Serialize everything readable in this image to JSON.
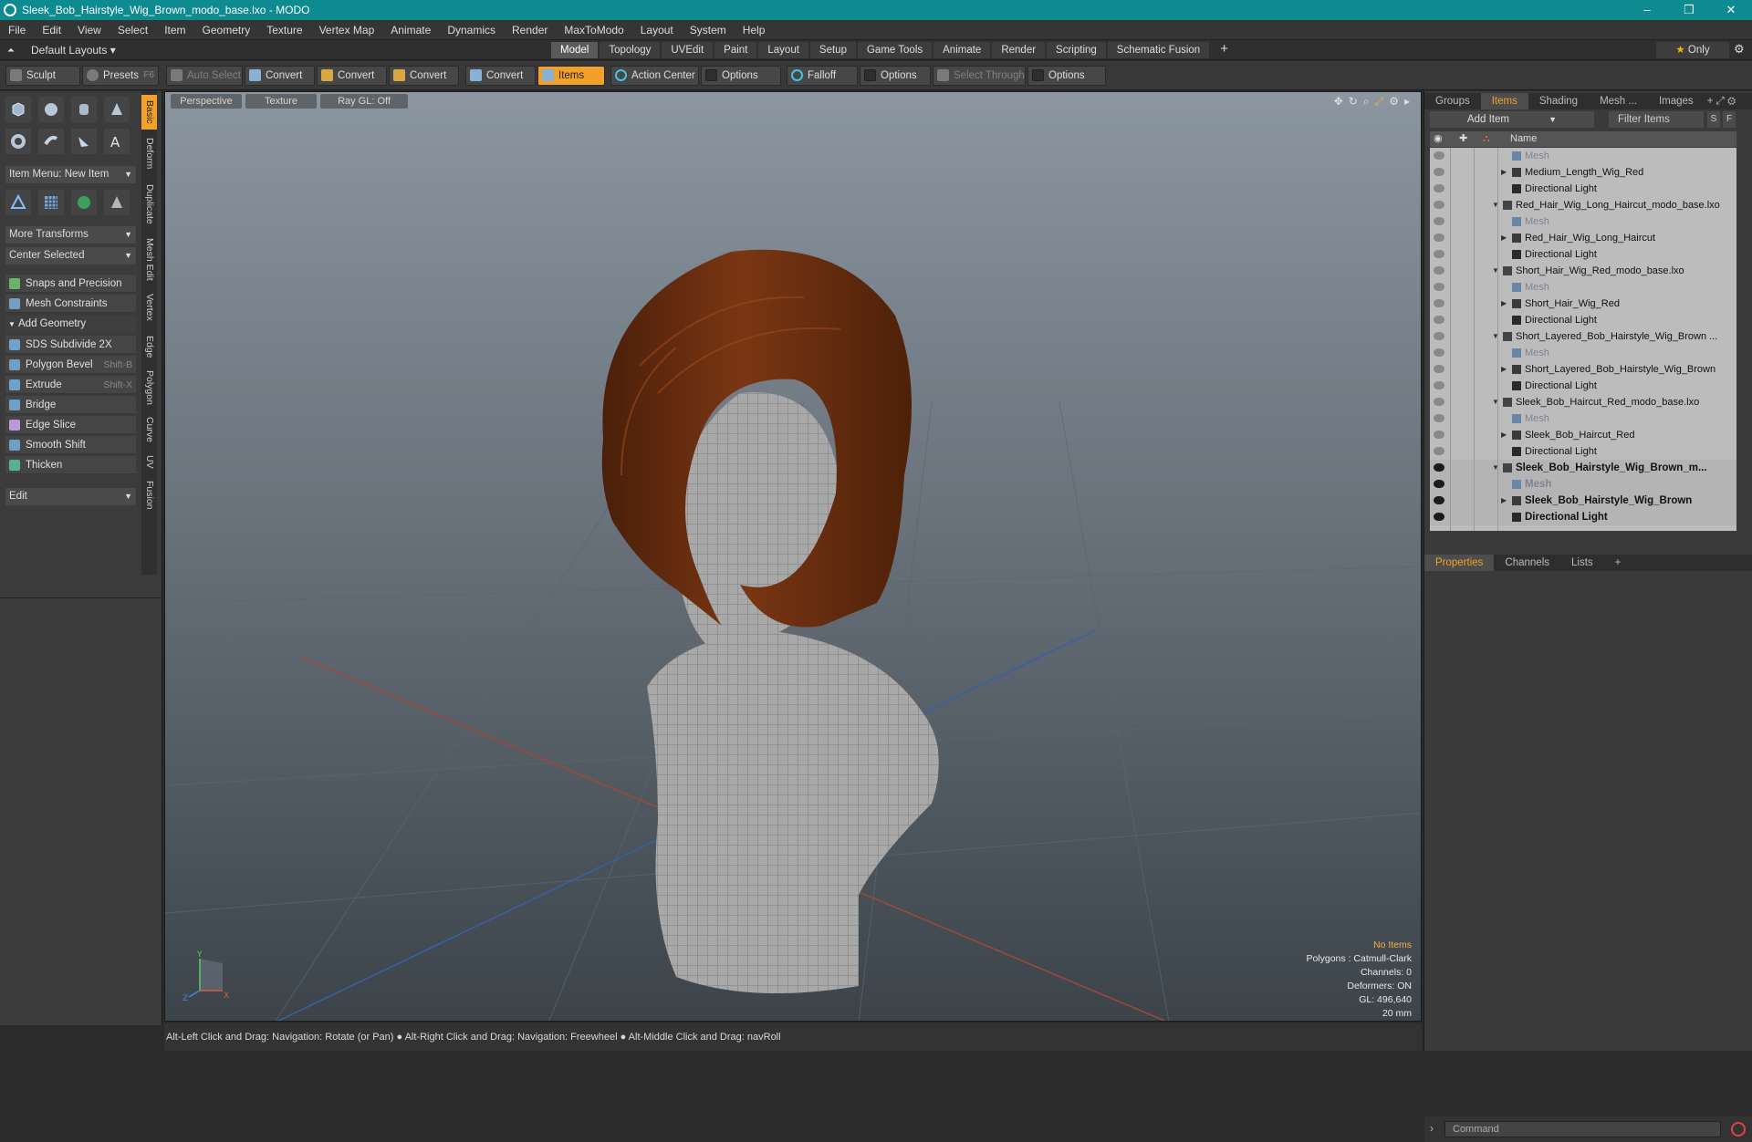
{
  "window": {
    "title": "Sleek_Bob_Hairstyle_Wig_Brown_modo_base.lxo - MODO",
    "min": "–",
    "max": "❐",
    "close": "✕"
  },
  "menu": [
    "File",
    "Edit",
    "View",
    "Select",
    "Item",
    "Geometry",
    "Texture",
    "Vertex Map",
    "Animate",
    "Dynamics",
    "Render",
    "MaxToModo",
    "Layout",
    "System",
    "Help"
  ],
  "layouts": {
    "label": "Default Layouts ▾"
  },
  "mode_tabs": [
    "Model",
    "Topology",
    "UVEdit",
    "Paint",
    "Layout",
    "Setup",
    "Game Tools",
    "Animate",
    "Render",
    "Scripting",
    "Schematic Fusion"
  ],
  "mode_active": "Model",
  "only_label": "Only",
  "toolbar": {
    "sculpt": "Sculpt",
    "presets": "Presets",
    "presets_key": "F6",
    "auto_select": "Auto Select",
    "convert1": "Convert",
    "convert2": "Convert",
    "convert3": "Convert",
    "convert4": "Convert",
    "items": "Items",
    "action_center": "Action Center",
    "options1": "Options",
    "falloff": "Falloff",
    "options2": "Options",
    "select_through": "Select Through",
    "options3": "Options"
  },
  "left": {
    "item_menu": "Item Menu: New Item",
    "more_transforms": "More Transforms",
    "center_selected": "Center Selected",
    "snaps": "Snaps and Precision",
    "mesh_constraints": "Mesh Constraints",
    "add_geometry": "Add Geometry",
    "tools": [
      {
        "label": "SDS Subdivide 2X",
        "key": ""
      },
      {
        "label": "Polygon Bevel",
        "key": "Shift-B"
      },
      {
        "label": "Extrude",
        "key": "Shift-X"
      },
      {
        "label": "Bridge",
        "key": ""
      },
      {
        "label": "Edge Slice",
        "key": ""
      },
      {
        "label": "Smooth Shift",
        "key": ""
      },
      {
        "label": "Thicken",
        "key": ""
      }
    ],
    "edit": "Edit",
    "vtabs": [
      "Basic",
      "Deform",
      "Duplicate",
      "Mesh Edit",
      "Vertex",
      "Edge",
      "Polygon",
      "Curve",
      "UV",
      "Fusion"
    ]
  },
  "viewport": {
    "tabs": [
      "Perspective",
      "Texture",
      "Ray GL: Off"
    ],
    "info": {
      "no_items": "No Items",
      "polygons": "Polygons : Catmull-Clark",
      "channels": "Channels: 0",
      "deformers": "Deformers: ON",
      "gl": "GL: 496,640",
      "scale": "20 mm"
    },
    "axis": {
      "y": "Y",
      "z": "Z",
      "x": "X"
    }
  },
  "status": "Alt-Left Click and Drag: Navigation: Rotate (or Pan) ● Alt-Right Click and Drag: Navigation: Freewheel ● Alt-Middle Click and Drag: navRoll",
  "right": {
    "tabs": [
      "Groups",
      "Items",
      "Shading",
      "Mesh ...",
      "Images"
    ],
    "active_tab": "Items",
    "add_item": "Add Item",
    "filter": "Filter Items",
    "s": "S",
    "f": "F",
    "col_name": "Name",
    "tree": [
      {
        "label": "Mesh",
        "kind": "mesh",
        "indent": 2
      },
      {
        "label": "Medium_Length_Wig_Red",
        "kind": "item",
        "indent": 2
      },
      {
        "label": "Directional Light",
        "kind": "light",
        "indent": 2
      },
      {
        "label": "Red_Hair_Wig_Long_Haircut_modo_base.lxo",
        "kind": "scene",
        "indent": 1
      },
      {
        "label": "Mesh",
        "kind": "mesh",
        "indent": 2
      },
      {
        "label": "Red_Hair_Wig_Long_Haircut",
        "kind": "item",
        "indent": 2
      },
      {
        "label": "Directional Light",
        "kind": "light",
        "indent": 2
      },
      {
        "label": "Short_Hair_Wig_Red_modo_base.lxo",
        "kind": "scene",
        "indent": 1
      },
      {
        "label": "Mesh",
        "kind": "mesh",
        "indent": 2
      },
      {
        "label": "Short_Hair_Wig_Red",
        "kind": "item",
        "indent": 2
      },
      {
        "label": "Directional Light",
        "kind": "light",
        "indent": 2
      },
      {
        "label": "Short_Layered_Bob_Hairstyle_Wig_Brown ...",
        "kind": "scene",
        "indent": 1
      },
      {
        "label": "Mesh",
        "kind": "mesh",
        "indent": 2
      },
      {
        "label": "Short_Layered_Bob_Hairstyle_Wig_Brown",
        "kind": "item",
        "indent": 2
      },
      {
        "label": "Directional Light",
        "kind": "light",
        "indent": 2
      },
      {
        "label": "Sleek_Bob_Haircut_Red_modo_base.lxo",
        "kind": "scene",
        "indent": 1
      },
      {
        "label": "Mesh",
        "kind": "mesh",
        "indent": 2
      },
      {
        "label": "Sleek_Bob_Haircut_Red",
        "kind": "item",
        "indent": 2
      },
      {
        "label": "Directional Light",
        "kind": "light",
        "indent": 2
      },
      {
        "label": "Sleek_Bob_Hairstyle_Wig_Brown_m...",
        "kind": "scene-bold",
        "indent": 1
      },
      {
        "label": "Mesh",
        "kind": "mesh-bold",
        "indent": 2
      },
      {
        "label": "Sleek_Bob_Hairstyle_Wig_Brown",
        "kind": "item-bold",
        "indent": 2
      },
      {
        "label": "Directional Light",
        "kind": "light-bold",
        "indent": 2
      }
    ],
    "props_tabs": [
      "Properties",
      "Channels",
      "Lists"
    ],
    "props_active": "Properties",
    "command_placeholder": "Command"
  },
  "colors": {
    "accent": "#f1a12a",
    "titlebar": "#0e8a91",
    "hair": "#6b2e10"
  }
}
